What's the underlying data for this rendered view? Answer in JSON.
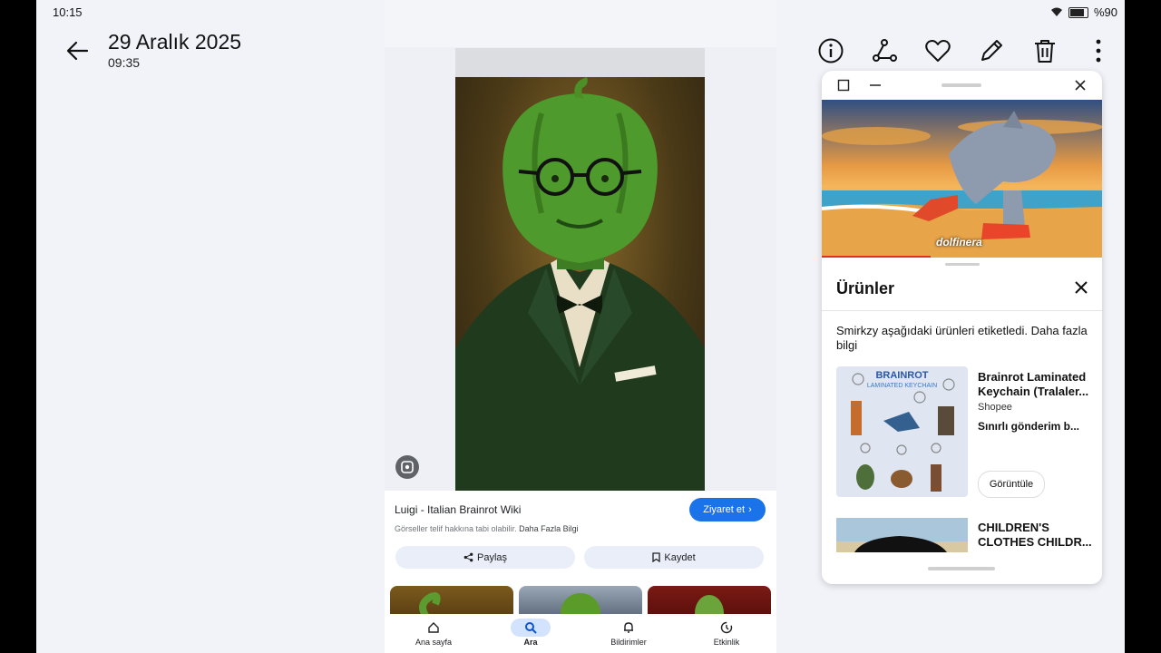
{
  "status_bar": {
    "time": "10:15",
    "battery": "%90"
  },
  "header": {
    "date": "29 Aralık 2025",
    "time": "09:35"
  },
  "toolbar": {
    "icons": [
      "info-icon",
      "share-icon",
      "heart-icon",
      "edit-icon",
      "trash-icon",
      "more-icon"
    ]
  },
  "image_result": {
    "source_title": "Luigi - Italian Brainrot Wiki",
    "copyright_note": "Görseller telif hakkına tabi olabilir.",
    "learn_more": "Daha Fazla Bilgi",
    "visit_label": "Ziyaret et",
    "share_label": "Paylaş",
    "save_label": "Kaydet"
  },
  "google_nav": [
    {
      "label": "Ana sayfa",
      "icon": "home-icon"
    },
    {
      "label": "Ara",
      "icon": "search-icon"
    },
    {
      "label": "Bildirimler",
      "icon": "bell-icon"
    },
    {
      "label": "Etkinlik",
      "icon": "activity-icon"
    }
  ],
  "video": {
    "caption": "dolfinera"
  },
  "products_sheet": {
    "title": "Ürünler",
    "description": "Smirkzy aşağıdaki ürünleri etiketledi. Daha fazla bilgi",
    "items": [
      {
        "name": "Brainrot Laminated Keychain (Tralaler...",
        "shop": "Shopee",
        "shipping": "Sınırlı gönderim b...",
        "button": "Görüntüle",
        "image_heading": "BRAINROT",
        "image_subheading": "LAMINATED KEYCHAIN"
      },
      {
        "name": "CHILDREN'S CLOTHES CHILDR..."
      }
    ]
  },
  "colors": {
    "accent": "#1a73e8",
    "pill_bg": "#e9eef8",
    "screen_bg": "#f1f3f8"
  }
}
